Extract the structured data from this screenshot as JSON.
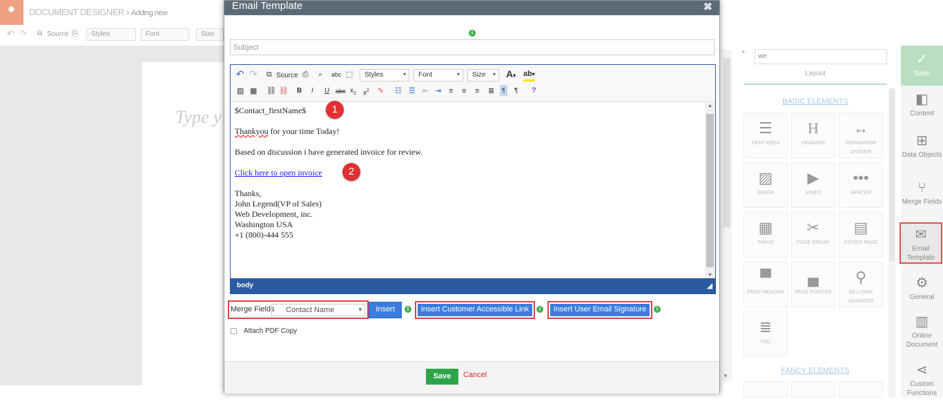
{
  "app": {
    "title": "DOCUMENT DESIGNER",
    "breadcrumb_sep": "›",
    "breadcrumb": "Adding new",
    "toolbar": {
      "source": "Source",
      "styles": "Styles",
      "font": "Font",
      "size": "Size"
    },
    "canvas_hint": "Type y"
  },
  "modal": {
    "title": "Email Template",
    "close": "✖",
    "subject_placeholder": "Subject",
    "editor_toolbar": {
      "source": "Source",
      "styles": "Styles",
      "font": "Font",
      "size": "Size"
    },
    "body_lines": {
      "greeting": "$Contact_firstName$",
      "thanks_word": "Thankyou",
      "thanks_rest": " for your time Today!",
      "discussion": "Based on discussion i have generated invoice for review.",
      "link": "Click here to open invoice",
      "sig1": "Thanks,",
      "sig2": "John Legend(VP of Sales)",
      "sig3": "Web Development, inc.",
      "sig4": "Washington USA",
      "sig5": "+1 (800)-444 555"
    },
    "badges": {
      "b1": "1",
      "b2": "2"
    },
    "editor_path": "body",
    "merge_fields_label": "Merge Fields",
    "merge_fields_value": "Contact Name",
    "insert_label": "Insert",
    "insert_link_label": "Insert Customer Accessible Link",
    "insert_signature_label": "Insert User Email Signature",
    "attach_pdf_label": "Attach PDF Copy",
    "save_label": "Save",
    "cancel_label": "Cancel"
  },
  "panel": {
    "search_value": "we",
    "layout_tab": "Layout",
    "basic_heading": "BASIC ELEMENTS",
    "fancy_heading": "FANCY ELEMENTS",
    "elements": {
      "text_area": "TEXT AREA",
      "heading": "HEADING",
      "separator": "SEPARATOR DIVIDER",
      "image": "IMAGE",
      "video": "VIDEO",
      "spacer": "SPACER",
      "table": "TABLE",
      "page_break": "PAGE BREAK",
      "cover_page": "COVER PAGE",
      "page_header": "PAGE HEADER",
      "page_footer": "PAGE FOOTER",
      "bill_ship": "BILL/SHIP ADDRESS",
      "toc": "TOC"
    }
  },
  "sidebar": {
    "save": "Save",
    "content": "Content",
    "data_objects": "Data Objects",
    "merge_fields": "Merge Fields",
    "email_template": "Email Template",
    "general": "General",
    "online_document": "Online Document",
    "custom_functions": "Custom Functions"
  },
  "colors": {
    "header": "#5c6a78",
    "accent_blue": "#3b7ddd",
    "save_green": "#2ea54a",
    "highlight_red": "#e04040",
    "editor_footer": "#2a5aa0"
  }
}
